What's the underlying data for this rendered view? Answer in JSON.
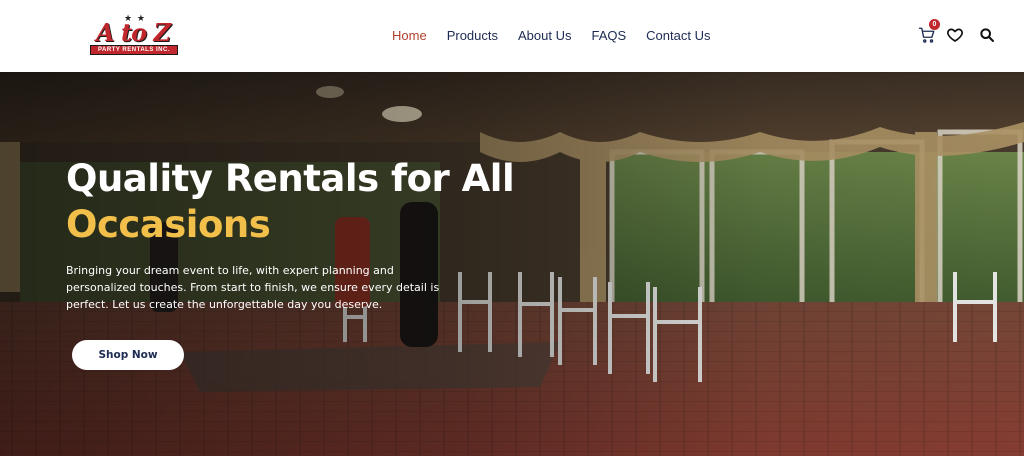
{
  "brand": {
    "logo_text": "A to Z",
    "logo_subtitle": "PARTY RENTALS INC."
  },
  "nav": {
    "items": [
      {
        "label": "Home",
        "active": true
      },
      {
        "label": "Products",
        "active": false
      },
      {
        "label": "About Us",
        "active": false
      },
      {
        "label": "FAQS",
        "active": false
      },
      {
        "label": "Contact Us",
        "active": false
      }
    ]
  },
  "header_icons": {
    "cart_icon": "cart-icon",
    "cart_count": "0",
    "wishlist_icon": "heart-icon",
    "search_icon": "search-icon"
  },
  "hero": {
    "title_line1": "Quality Rentals for All",
    "title_line2": "Occasions",
    "description": "Bringing your dream event to life, with expert planning and personalized touches. From start to finish, we ensure every detail is perfect. Let us create the unforgettable day you deserve.",
    "cta_label": "Shop Now"
  },
  "colors": {
    "accent_yellow": "#f2c04a",
    "active_nav": "#b2422f",
    "nav_text": "#1d2b52",
    "brand_red": "#c0282d"
  }
}
